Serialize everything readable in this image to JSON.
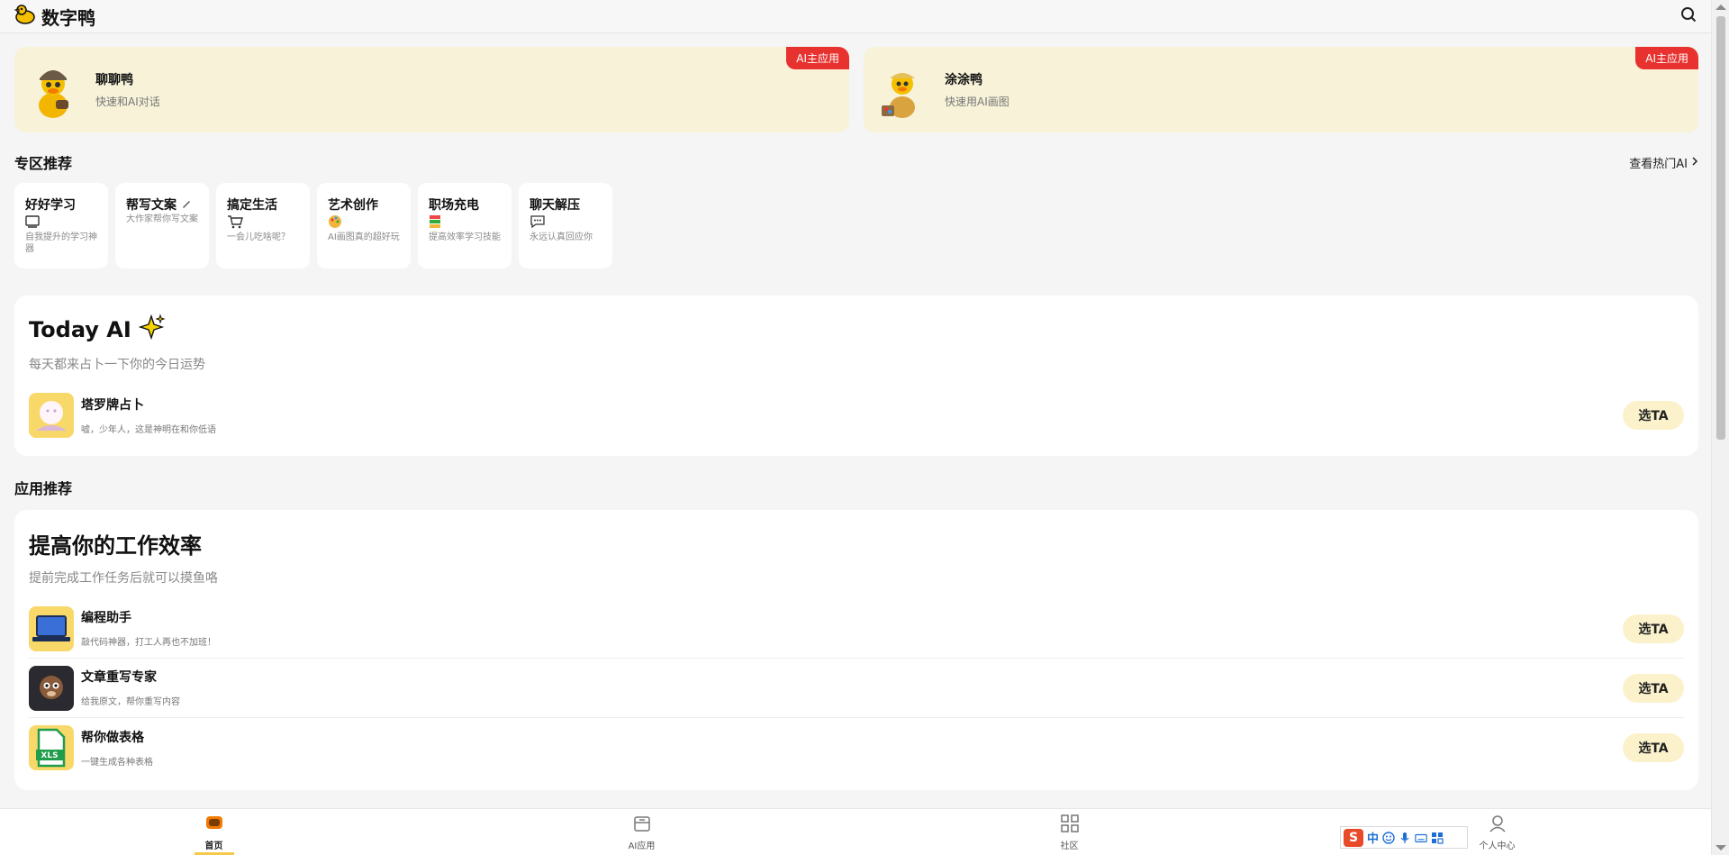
{
  "header": {
    "brand": "数字鸭"
  },
  "features": [
    {
      "title": "聊聊鸭",
      "sub": "快速和AI对话",
      "badge": "AI主应用"
    },
    {
      "title": "涂涂鸭",
      "sub": "快速用AI画图",
      "badge": "AI主应用"
    }
  ],
  "zones": {
    "title": "专区推荐",
    "link": "查看热门AI",
    "items": [
      {
        "title": "好好学习",
        "sub": "自我提升的学习神器"
      },
      {
        "title": "帮写文案",
        "sub": "大作家帮你写文案"
      },
      {
        "title": "搞定生活",
        "sub": "一会儿吃啥呢？"
      },
      {
        "title": "艺术创作",
        "sub": "AI画图真的超好玩"
      },
      {
        "title": "职场充电",
        "sub": "提高效率学习技能"
      },
      {
        "title": "聊天解压",
        "sub": "永远认真回应你"
      }
    ]
  },
  "today": {
    "title": "Today AI",
    "sub": "每天都来占卜一下你的今日运势",
    "apps": [
      {
        "name": "塔罗牌占卜",
        "desc": "嘘，少年人，这是神明在和你低语",
        "btn": "选TA"
      }
    ]
  },
  "apps_section": {
    "title": "应用推荐",
    "panel_title": "提高你的工作效率",
    "panel_sub": "提前完成工作任务后就可以摸鱼咯",
    "apps": [
      {
        "name": "编程助手",
        "desc": "敲代码神器，打工人再也不加班！",
        "btn": "选TA"
      },
      {
        "name": "文章重写专家",
        "desc": "给我原文，帮你重写内容",
        "btn": "选TA"
      },
      {
        "name": "帮你做表格",
        "desc": "一键生成各种表格",
        "btn": "选TA"
      }
    ]
  },
  "nav": [
    {
      "label": "首页"
    },
    {
      "label": "AI应用"
    },
    {
      "label": "社区"
    },
    {
      "label": "个人中心"
    }
  ],
  "ime": {
    "logo": "S",
    "lang": "中"
  },
  "colors": {
    "accent": "#f6c94c",
    "badge": "#e8322f",
    "feature_bg": "#f7f2d8",
    "pick_btn": "#fbf2cc"
  }
}
